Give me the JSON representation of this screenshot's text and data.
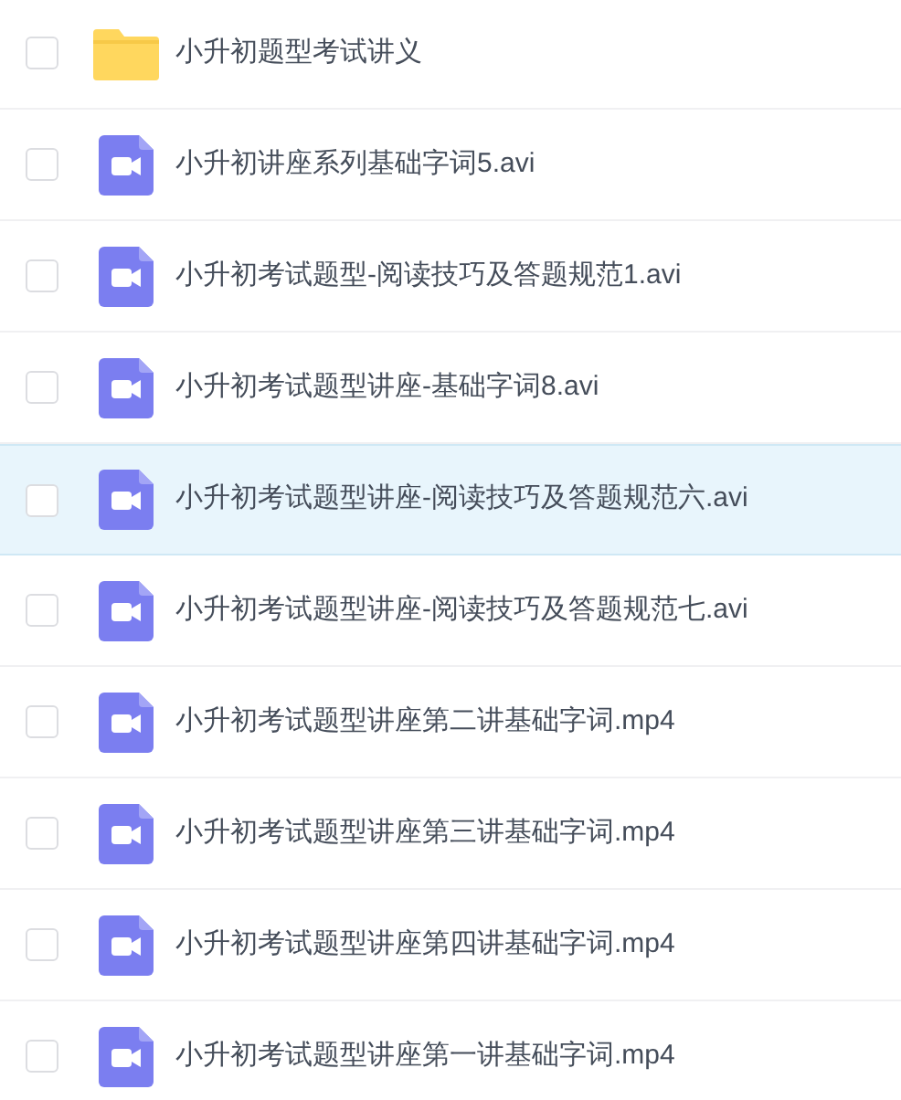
{
  "files": [
    {
      "kind": "folder",
      "name": "小升初题型考试讲义",
      "checked": false,
      "selected": false
    },
    {
      "kind": "video",
      "name": "小升初讲座系列基础字词5.avi",
      "checked": false,
      "selected": false
    },
    {
      "kind": "video",
      "name": "小升初考试题型-阅读技巧及答题规范1.avi",
      "checked": false,
      "selected": false
    },
    {
      "kind": "video",
      "name": "小升初考试题型讲座-基础字词8.avi",
      "checked": false,
      "selected": false
    },
    {
      "kind": "video",
      "name": "小升初考试题型讲座-阅读技巧及答题规范六.avi",
      "checked": false,
      "selected": true
    },
    {
      "kind": "video",
      "name": "小升初考试题型讲座-阅读技巧及答题规范七.avi",
      "checked": false,
      "selected": false
    },
    {
      "kind": "video",
      "name": "小升初考试题型讲座第二讲基础字词.mp4",
      "checked": false,
      "selected": false
    },
    {
      "kind": "video",
      "name": "小升初考试题型讲座第三讲基础字词.mp4",
      "checked": false,
      "selected": false
    },
    {
      "kind": "video",
      "name": "小升初考试题型讲座第四讲基础字词.mp4",
      "checked": false,
      "selected": false
    },
    {
      "kind": "video",
      "name": "小升初考试题型讲座第一讲基础字词.mp4",
      "checked": false,
      "selected": false
    }
  ]
}
